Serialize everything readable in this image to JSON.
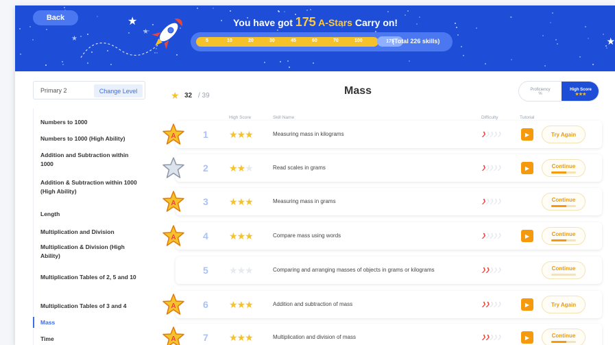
{
  "header": {
    "back_label": "Back",
    "headline_pre": "You have got",
    "headline_count": "175",
    "headline_astars": "A-Stars",
    "headline_post": "Carry on!",
    "progress_numbers": [
      "5",
      "10",
      "20",
      "30",
      "45",
      "60",
      "70",
      "100"
    ],
    "progress_current": "175",
    "progress_total": "(Total 226 skills)",
    "accent": "#1e4ed8",
    "star_color": "#f6c22b"
  },
  "level": {
    "current": "Primary 2",
    "change_label": "Change Level"
  },
  "sidebar": {
    "items": [
      {
        "label": "Numbers to 1000",
        "active": false
      },
      {
        "label": "Numbers to 1000 (High Ability)",
        "active": false
      },
      {
        "label": "Addition and Subtraction within 1000",
        "active": false
      },
      {
        "label": "Addition & Subtraction within 1000 (High Ability)",
        "active": false
      },
      {
        "label": "Length",
        "active": false
      },
      {
        "label": "Multiplication and Division",
        "active": false
      },
      {
        "label": "Multiplication & Division (High Ability)",
        "active": false
      },
      {
        "label": "Multiplication Tables of 2, 5 and 10",
        "active": false
      },
      {
        "label": "Multiplication Tables of 3 and 4",
        "active": false
      },
      {
        "label": "Mass",
        "active": true
      },
      {
        "label": "Time",
        "active": false
      }
    ]
  },
  "main": {
    "score_current": "32",
    "score_total": "/ 39",
    "title": "Mass",
    "toggle_proficiency": "Proficiency",
    "toggle_proficiency_sub": "%",
    "toggle_high": "High Score",
    "toggle_high_sub": "★★★",
    "columns": {
      "high_score": "High Score",
      "skill_name": "Skill Name",
      "difficulty": "Difficulty",
      "tutorial": "Tutorial"
    },
    "rows": [
      {
        "num": "1",
        "badge": "gold",
        "stars": 3,
        "name": "Measuring mass in kilograms",
        "difficulty": 1,
        "tutorial": true,
        "action": "Try Again",
        "progress": 0
      },
      {
        "num": "2",
        "badge": "silver",
        "stars": 2,
        "name": "Read scales in grams",
        "difficulty": 1,
        "tutorial": true,
        "action": "Continue",
        "progress": 0.6
      },
      {
        "num": "3",
        "badge": "gold",
        "stars": 3,
        "name": "Measuring mass in grams",
        "difficulty": 1,
        "tutorial": false,
        "action": "Continue",
        "progress": 0.6
      },
      {
        "num": "4",
        "badge": "gold",
        "stars": 3,
        "name": "Compare mass using words",
        "difficulty": 1,
        "tutorial": true,
        "action": "Continue",
        "progress": 0.6
      },
      {
        "num": "5",
        "badge": "none",
        "stars": 0,
        "name": "Comparing and arranging masses of objects in grams or kilograms",
        "difficulty": 2,
        "tutorial": false,
        "action": "Continue",
        "progress": 0
      },
      {
        "num": "6",
        "badge": "gold",
        "stars": 3,
        "name": "Addition and subtraction of mass",
        "difficulty": 2,
        "tutorial": true,
        "action": "Try Again",
        "progress": 0
      },
      {
        "num": "7",
        "badge": "gold",
        "stars": 3,
        "name": "Multiplication and division of mass",
        "difficulty": 2,
        "tutorial": true,
        "action": "Continue",
        "progress": 0.6
      }
    ]
  }
}
